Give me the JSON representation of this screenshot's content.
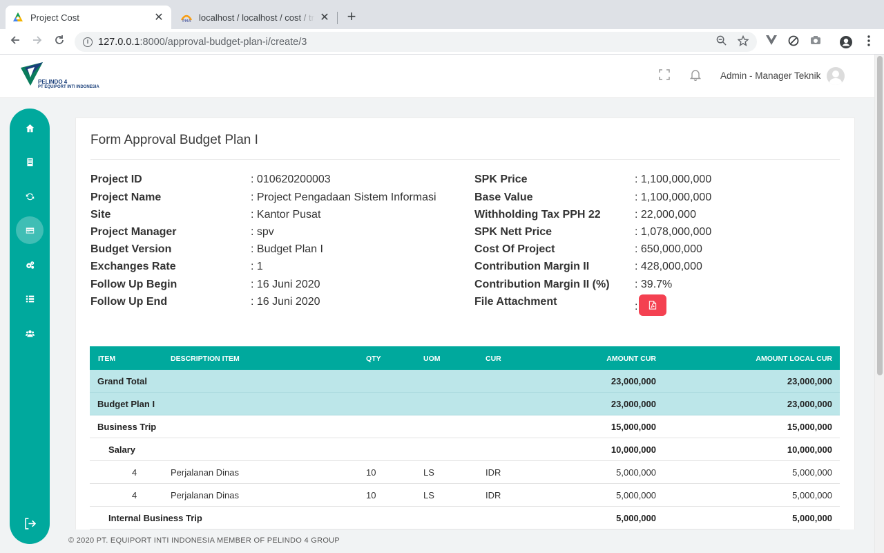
{
  "browser": {
    "tabs": [
      {
        "title": "Project Cost",
        "favicon": "google-drive-like-icon",
        "active": true
      },
      {
        "title": "localhost / localhost / cost / tra",
        "favicon": "phpmyadmin-icon",
        "active": false
      }
    ],
    "new_tab": "+",
    "url_host": "127.0.0.1",
    "url_rest": ":8000/approval-budget-plan-i/create/3"
  },
  "header": {
    "logo_line1": "PELINDO 4",
    "logo_line2": "PT EQUIPORT INTI INDONESIA",
    "user": "Admin - Manager Teknik"
  },
  "sidebar": {
    "items": [
      {
        "name": "home",
        "icon": "home-icon"
      },
      {
        "name": "document",
        "icon": "document-icon"
      },
      {
        "name": "sync",
        "icon": "refresh-icon"
      },
      {
        "name": "budget",
        "icon": "credit-card-icon",
        "active": true
      },
      {
        "name": "settings",
        "icon": "cogs-icon"
      },
      {
        "name": "list",
        "icon": "list-icon"
      },
      {
        "name": "users",
        "icon": "users-icon"
      }
    ],
    "logout_icon": "logout-icon"
  },
  "form": {
    "title": "Form Approval Budget Plan I",
    "left": [
      {
        "label": "Project ID",
        "value": ": 010620200003"
      },
      {
        "label": "Project Name",
        "value": ": Project Pengadaan Sistem Informasi"
      },
      {
        "label": "Site",
        "value": ": Kantor Pusat"
      },
      {
        "label": "Project Manager",
        "value": ": spv"
      },
      {
        "label": "Budget Version",
        "value": ": Budget Plan I"
      },
      {
        "label": "Exchanges Rate",
        "value": ": 1"
      },
      {
        "label": "Follow Up Begin",
        "value": ": 16 Juni 2020"
      },
      {
        "label": "Follow Up End",
        "value": ": 16 Juni 2020"
      }
    ],
    "right": [
      {
        "label": "SPK Price",
        "value": ": 1,100,000,000"
      },
      {
        "label": "Base Value",
        "value": ": 1,100,000,000"
      },
      {
        "label": "Withholding Tax PPH 22",
        "value": ": 22,000,000"
      },
      {
        "label": "SPK Nett Price",
        "value": ": 1,078,000,000"
      },
      {
        "label": "Cost Of Project",
        "value": ": 650,000,000"
      },
      {
        "label": "Contribution Margin II",
        "value": ": 428,000,000"
      },
      {
        "label": "Contribution Margin II (%)",
        "value": ": 39.7%"
      },
      {
        "label": "File Attachment",
        "value": ":"
      }
    ]
  },
  "table": {
    "headers": [
      "ITEM",
      "DESCRIPTION ITEM",
      "QTY",
      "UOM",
      "CUR",
      "AMOUNT CUR",
      "AMOUNT LOCAL CUR"
    ],
    "rows": [
      {
        "kind": "total",
        "label": "Grand Total",
        "amount_cur": "23,000,000",
        "amount_local": "23,000,000"
      },
      {
        "kind": "total",
        "label": "Budget Plan I",
        "amount_cur": "23,000,000",
        "amount_local": "23,000,000"
      },
      {
        "kind": "group",
        "label": "Business Trip",
        "amount_cur": "15,000,000",
        "amount_local": "15,000,000"
      },
      {
        "kind": "subgroup",
        "label": "Salary",
        "amount_cur": "10,000,000",
        "amount_local": "10,000,000"
      },
      {
        "kind": "item",
        "item": "4",
        "desc": "Perjalanan Dinas",
        "qty": "10",
        "uom": "LS",
        "cur": "IDR",
        "amount_cur": "5,000,000",
        "amount_local": "5,000,000"
      },
      {
        "kind": "item",
        "item": "4",
        "desc": "Perjalanan Dinas",
        "qty": "10",
        "uom": "LS",
        "cur": "IDR",
        "amount_cur": "5,000,000",
        "amount_local": "5,000,000"
      },
      {
        "kind": "subgroup",
        "label": "Internal Business Trip",
        "amount_cur": "5,000,000",
        "amount_local": "5,000,000"
      }
    ]
  },
  "footer": {
    "text": "© 2020 PT. EQUIPORT INTI INDONESIA MEMBER OF PELINDO 4 GROUP"
  },
  "colors": {
    "accent": "#00a99d",
    "total_row": "#bce6e9",
    "pdf_button": "#f44151"
  }
}
